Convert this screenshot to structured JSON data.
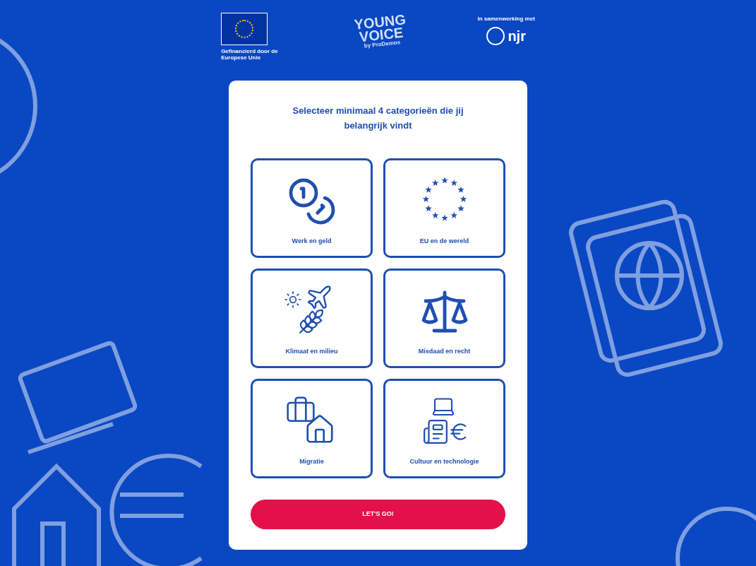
{
  "header": {
    "eu_caption": "Gefinancierd door de Europese Unie",
    "brand_top": "YOUNG",
    "brand_bottom": "VOICE",
    "brand_by": "by ProDemos",
    "partner_caption": "In samenwerking met",
    "partner_name": "njr"
  },
  "card": {
    "title": "Selecteer minimaal 4 categorieën die jij belangrijk vindt",
    "categories": [
      {
        "label": "Werk en geld",
        "selected": false
      },
      {
        "label": "EU en de wereld",
        "selected": false
      },
      {
        "label": "Klimaat en milieu",
        "selected": false
      },
      {
        "label": "Misdaad en recht",
        "selected": false
      },
      {
        "label": "Migratie",
        "selected": false
      },
      {
        "label": "Cultuur en technologie",
        "selected": false
      }
    ],
    "button": "LET'S GO!"
  }
}
